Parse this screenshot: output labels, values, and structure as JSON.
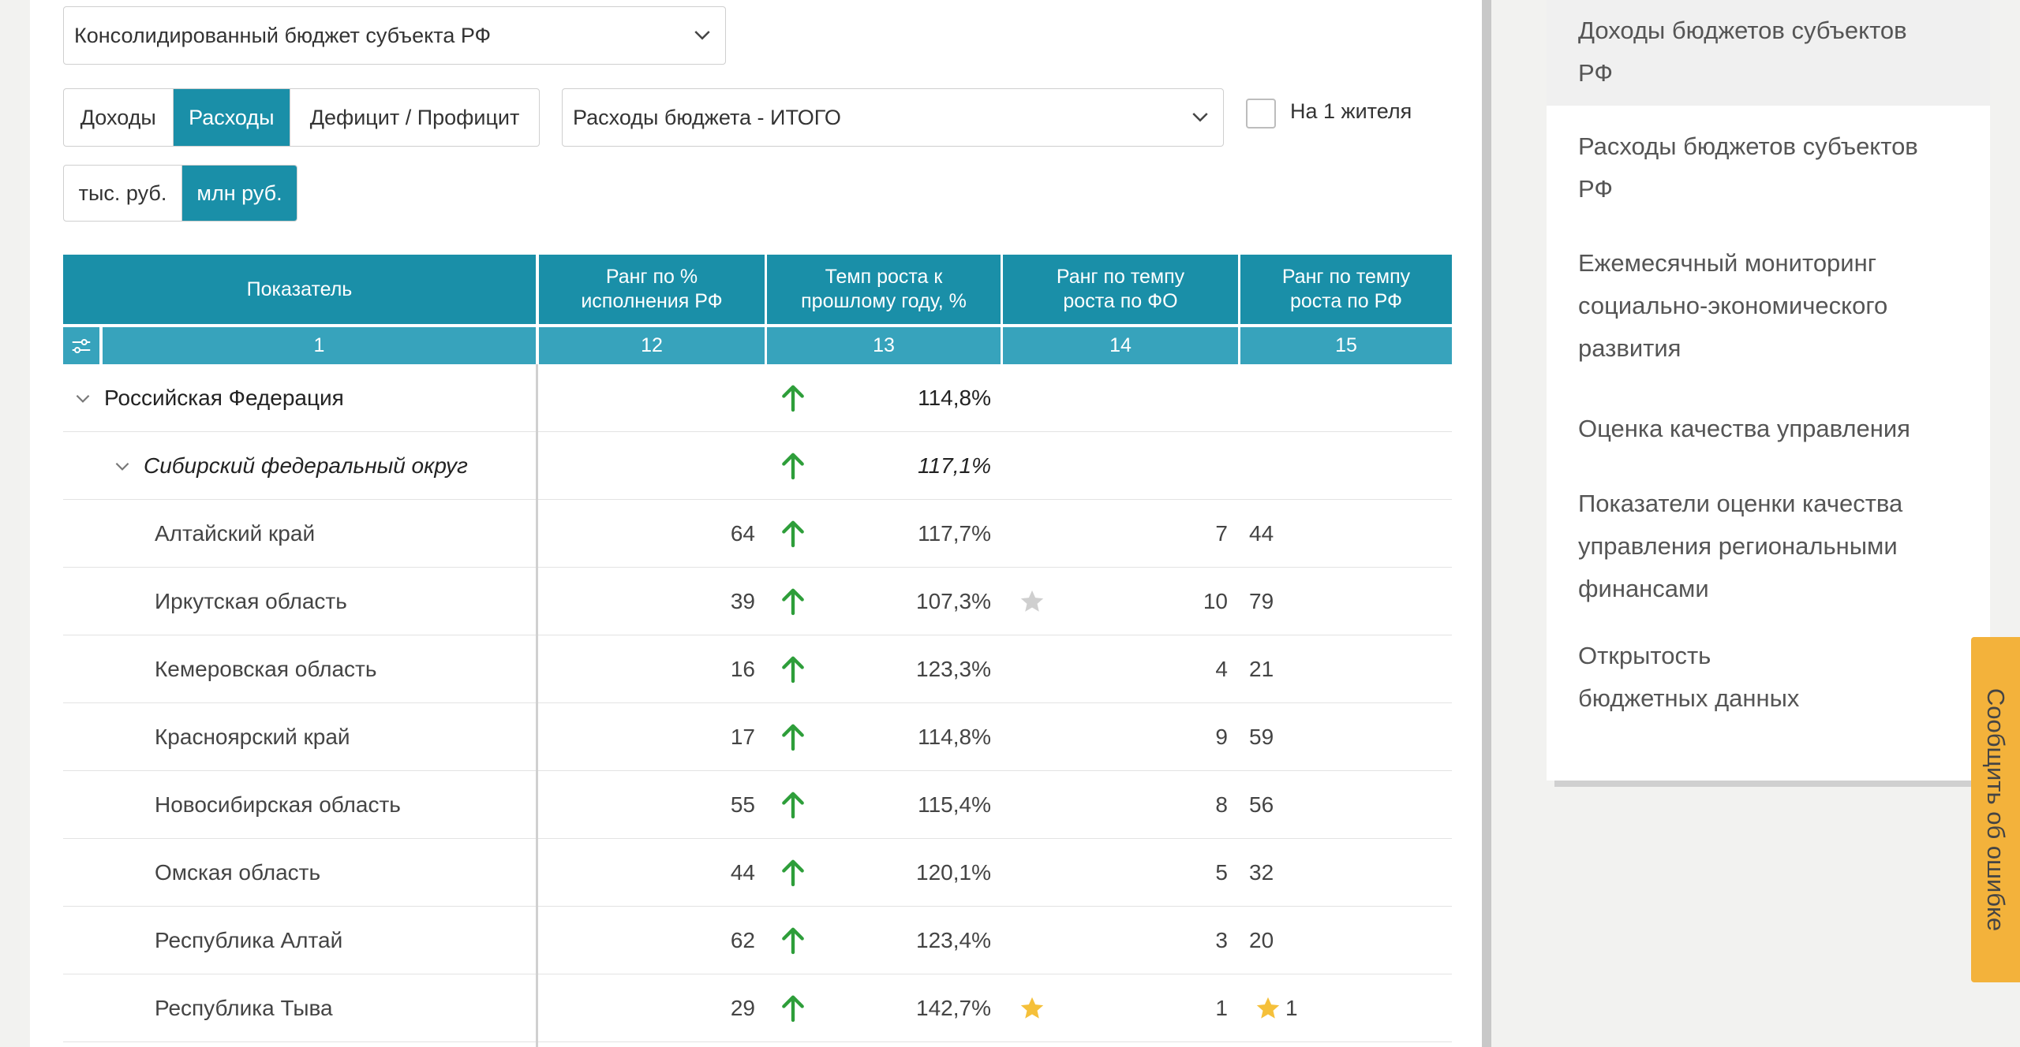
{
  "budget_select": {
    "value": "Консолидированный бюджет субъекта РФ"
  },
  "type_tabs": [
    "Доходы",
    "Расходы",
    "Дефицит / Профицит"
  ],
  "type_active_index": 1,
  "indicator_select": {
    "value": "Расходы бюджета - ИТОГО"
  },
  "per_capita": {
    "label": "На 1 жителя",
    "checked": false
  },
  "unit_tabs": [
    "тыс. руб.",
    "млн руб."
  ],
  "unit_active_index": 1,
  "table": {
    "headers": {
      "indicator": "Показатель",
      "rank_exec": "Ранг по % исполнения РФ",
      "growth": "Темп роста к прошлому году, %",
      "rank_fo": "Ранг по темпу роста по ФО",
      "rank_rf": "Ранг по темпу роста по РФ"
    },
    "col_numbers": {
      "indicator": "1",
      "rank_exec": "12",
      "growth": "13",
      "rank_fo": "14",
      "rank_rf": "15"
    },
    "rows": [
      {
        "name": "Российская Федерация",
        "level": 0,
        "rank_exec": "",
        "growth": "114,8%",
        "rank_fo": "",
        "rank_rf": "",
        "arrow": "up",
        "star_fo": "",
        "star_rf": ""
      },
      {
        "name": "Сибирский федеральный округ",
        "level": 1,
        "rank_exec": "",
        "growth": "117,1%",
        "rank_fo": "",
        "rank_rf": "",
        "arrow": "up",
        "star_fo": "",
        "star_rf": ""
      },
      {
        "name": "Алтайский край",
        "level": 2,
        "rank_exec": "64",
        "growth": "117,7%",
        "rank_fo": "7",
        "rank_rf": "44",
        "arrow": "up",
        "star_fo": "",
        "star_rf": ""
      },
      {
        "name": "Иркутская область",
        "level": 2,
        "rank_exec": "39",
        "growth": "107,3%",
        "rank_fo": "10",
        "rank_rf": "79",
        "arrow": "up",
        "star_fo": "grey",
        "star_rf": ""
      },
      {
        "name": "Кемеровская область",
        "level": 2,
        "rank_exec": "16",
        "growth": "123,3%",
        "rank_fo": "4",
        "rank_rf": "21",
        "arrow": "up",
        "star_fo": "",
        "star_rf": ""
      },
      {
        "name": "Красноярский край",
        "level": 2,
        "rank_exec": "17",
        "growth": "114,8%",
        "rank_fo": "9",
        "rank_rf": "59",
        "arrow": "up",
        "star_fo": "",
        "star_rf": ""
      },
      {
        "name": "Новосибирская область",
        "level": 2,
        "rank_exec": "55",
        "growth": "115,4%",
        "rank_fo": "8",
        "rank_rf": "56",
        "arrow": "up",
        "star_fo": "",
        "star_rf": ""
      },
      {
        "name": "Омская область",
        "level": 2,
        "rank_exec": "44",
        "growth": "120,1%",
        "rank_fo": "5",
        "rank_rf": "32",
        "arrow": "up",
        "star_fo": "",
        "star_rf": ""
      },
      {
        "name": "Республика Алтай",
        "level": 2,
        "rank_exec": "62",
        "growth": "123,4%",
        "rank_fo": "3",
        "rank_rf": "20",
        "arrow": "up",
        "star_fo": "",
        "star_rf": ""
      },
      {
        "name": "Республика Тыва",
        "level": 2,
        "rank_exec": "29",
        "growth": "142,7%",
        "rank_fo": "1",
        "rank_rf": "1",
        "arrow": "up",
        "star_fo": "gold",
        "star_rf": "gold"
      }
    ]
  },
  "sidebar": {
    "items": [
      {
        "lines": [
          "Доходы бюджетов субъектов",
          "РФ"
        ],
        "active": true
      },
      {
        "lines": [
          "Расходы бюджетов субъектов",
          "РФ"
        ],
        "active": false
      },
      {
        "lines": [
          "Ежемесячный мониторинг",
          "социально-экономического",
          "развития"
        ],
        "active": false
      },
      {
        "lines": [
          "Оценка качества управления"
        ],
        "active": false
      },
      {
        "lines": [
          "Показатели оценки качества",
          "управления региональными",
          "финансами"
        ],
        "active": false
      },
      {
        "lines": [
          "Открытость",
          "бюджетных данных"
        ],
        "active": false
      }
    ]
  },
  "report_error": {
    "label": "Сообщить об ошибке"
  },
  "colors": {
    "accent": "#1a8fa8",
    "header_sub": "#37a3bc",
    "arrow_up": "#2e9e3a",
    "star_gold": "#f5c03a",
    "star_grey": "#cfcfcf",
    "report_tab": "#f3b23b"
  },
  "icons": {
    "select_caret": "chevron-down-icon",
    "settings": "sliders-icon",
    "growth": "arrow-up-icon",
    "rank_star": "star-icon",
    "collapse": "chevron-down-icon"
  }
}
